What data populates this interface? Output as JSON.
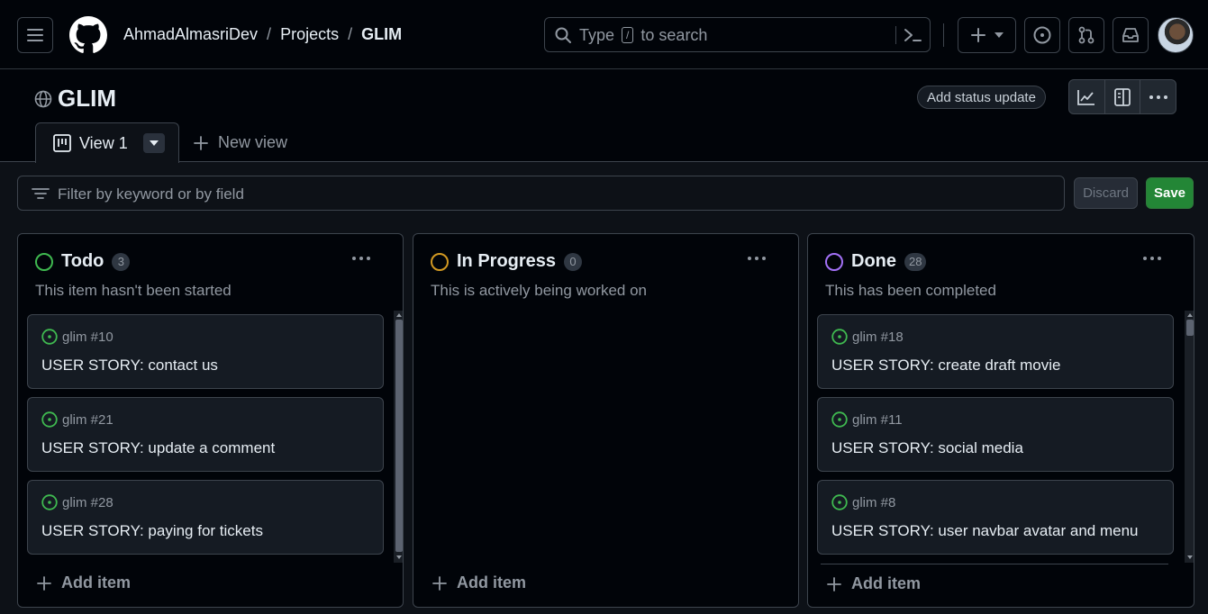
{
  "header": {
    "breadcrumb": {
      "owner": "AhmadAlmasriDev",
      "section": "Projects",
      "current": "GLIM",
      "separator": "/"
    },
    "search": {
      "prefix": "Type",
      "key": "/",
      "suffix": "to search"
    }
  },
  "project": {
    "title": "GLIM",
    "status_update_label": "Add status update"
  },
  "tabs": {
    "active": {
      "label": "View 1"
    },
    "new_view_label": "New view"
  },
  "filter": {
    "placeholder": "Filter by keyword or by field",
    "discard_label": "Discard",
    "save_label": "Save"
  },
  "columns": [
    {
      "name": "Todo",
      "count": "3",
      "description": "This item hasn't been started",
      "ring_color": "#3fb950",
      "add_label": "Add item",
      "cards": [
        {
          "ref": "glim #10",
          "title": "USER STORY: contact us"
        },
        {
          "ref": "glim #21",
          "title": "USER STORY: update a comment"
        },
        {
          "ref": "glim #28",
          "title": "USER STORY: paying for tickets"
        }
      ]
    },
    {
      "name": "In Progress",
      "count": "0",
      "description": "This is actively being worked on",
      "ring_color": "#d29922",
      "add_label": "Add item",
      "cards": []
    },
    {
      "name": "Done",
      "count": "28",
      "description": "This has been completed",
      "ring_color": "#a371f7",
      "add_label": "Add item",
      "cards": [
        {
          "ref": "glim #18",
          "title": "USER STORY: create draft movie"
        },
        {
          "ref": "glim #11",
          "title": "USER STORY: social media"
        },
        {
          "ref": "glim #8",
          "title": "USER STORY: user navbar avatar and menu"
        }
      ]
    }
  ],
  "icons": {
    "menu": "hamburger-icon",
    "logo": "github-logo",
    "search": "search-icon",
    "command": "command-palette-icon",
    "create": "plus-icon",
    "issues": "issue-opened-icon",
    "pulls": "git-pull-request-icon",
    "inbox": "inbox-icon",
    "globe": "globe-icon",
    "insights": "graph-icon",
    "layout": "sidebar-icon",
    "more": "kebab-horizontal-icon",
    "board": "project-board-icon",
    "filter": "filter-icon",
    "issue_status": "issue-opened-icon"
  },
  "colors": {
    "save_bg": "#238636",
    "open_issue": "#3fb950",
    "bg": "#010409",
    "border": "#3d444d"
  }
}
